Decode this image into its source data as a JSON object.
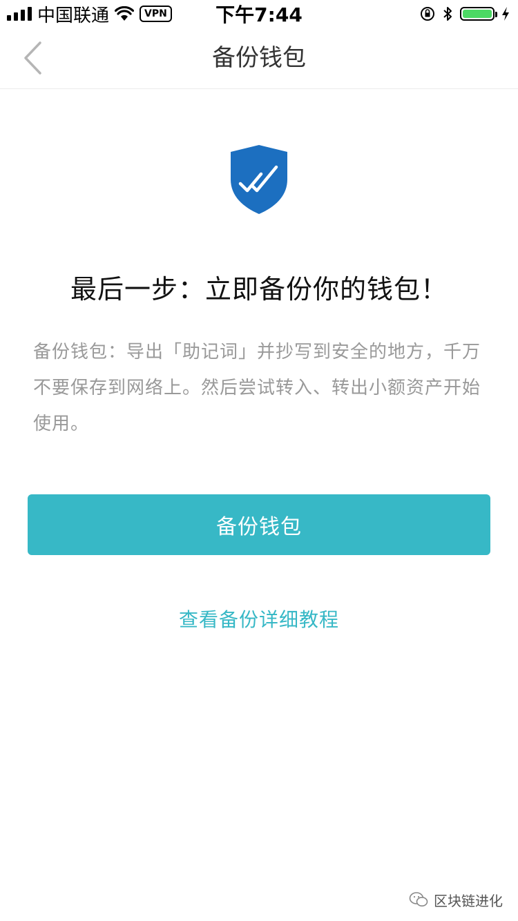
{
  "status_bar": {
    "carrier": "中国联通",
    "vpn": "VPN",
    "time": "下午7:44",
    "battery_color": "#4cd964"
  },
  "nav": {
    "title": "备份钱包",
    "back_icon": "chevron-left-icon"
  },
  "content": {
    "shield_icon": "shield-check-icon",
    "shield_color": "#1c6fc0",
    "headline": "最后一步：立即备份你的钱包！",
    "description": "备份钱包：导出「助记词」并抄写到安全的地方，千万不要保存到网络上。然后尝试转入、转出小额资产开始使用。",
    "primary_button": "备份钱包",
    "tutorial_link": "查看备份详细教程",
    "accent_color": "#37b8c6"
  },
  "watermark": {
    "text": "区块链进化"
  }
}
